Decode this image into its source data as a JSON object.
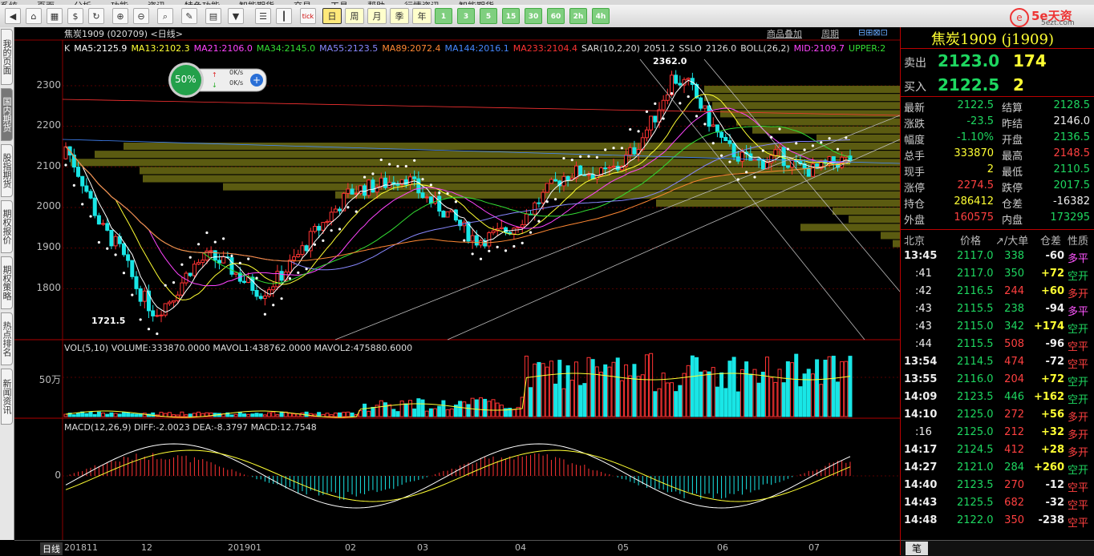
{
  "menubar": {
    "items": [
      "系统",
      "页面",
      "分析",
      "功能",
      "资讯",
      "特色功能",
      "智能期货",
      "交易",
      "工具",
      "帮助",
      "行情资讯",
      "智能期货"
    ]
  },
  "toolbar": {
    "periods": [
      "日",
      "周",
      "月",
      "季",
      "年"
    ],
    "cycles": [
      "1",
      "3",
      "5",
      "15",
      "30",
      "60",
      "2h",
      "4h"
    ],
    "logo_text": "5e天资",
    "logo_sub": "5ezt.com"
  },
  "left_tabs": [
    "我的页面",
    "国内期货",
    "股指期货",
    "期权报价",
    "期权策略",
    "热点排名",
    "新闻资讯"
  ],
  "chart": {
    "title_line": "焦炭1909 (020709) <日线>",
    "link_overlay": "商品叠加",
    "link_period": "周期",
    "indicators": [
      {
        "text": "K",
        "color": "#dddddd"
      },
      {
        "text": "MA5:2125.9",
        "color": "#ffffff"
      },
      {
        "text": "MA13:2102.3",
        "color": "#ffff33"
      },
      {
        "text": "MA21:2106.0",
        "color": "#ff44ff"
      },
      {
        "text": "MA34:2145.0",
        "color": "#33dd33"
      },
      {
        "text": "MA55:2123.5",
        "color": "#8888ff"
      },
      {
        "text": "MA89:2072.4",
        "color": "#ff8833"
      },
      {
        "text": "MA144:2016.1",
        "color": "#4488ff"
      },
      {
        "text": "MA233:2104.4",
        "color": "#ff3333"
      },
      {
        "text": "SAR(10,2,20)",
        "color": "#dddddd"
      },
      {
        "text": "2051.2",
        "color": "#dddddd"
      },
      {
        "text": "SSLO",
        "color": "#dddddd"
      },
      {
        "text": "2126.0",
        "color": "#dddddd"
      },
      {
        "text": "BOLL(26,2)",
        "color": "#dddddd"
      },
      {
        "text": "MID:2109.7",
        "color": "#ff44ff"
      },
      {
        "text": "UPPER:2",
        "color": "#33dd33"
      }
    ],
    "y_ticks": [
      "2300",
      "2200",
      "2100",
      "2000",
      "1900",
      "1800"
    ],
    "high_label": "2362.0",
    "low_label": "1721.5",
    "speed_widget": {
      "percent": "50%",
      "up": "0K/s",
      "down": "0K/s"
    },
    "vol_header": "VOL(5,10) VOLUME:333870.0000 MAVOL1:438762.0000 MAVOL2:475880.6000",
    "vol_tick": "50万",
    "macd_header": "MACD(12,26,9) DIFF:-2.0023 DEA:-8.3797 MACD:12.7548",
    "macd_tick": "0",
    "x_period": "日线",
    "x_labels": [
      "201811",
      "12",
      "201901",
      "02",
      "03",
      "04",
      "05",
      "06",
      "07"
    ]
  },
  "quote": {
    "name": "焦炭1909 (j1909)",
    "sell_label": "卖出",
    "sell_price": "2123.0",
    "sell_vol": "174",
    "buy_label": "买入",
    "buy_price": "2122.5",
    "buy_vol": "2",
    "stats": [
      {
        "l1": "最新",
        "v1": "2122.5",
        "c1": "g",
        "l2": "结算",
        "v2": "2128.5",
        "c2": "g"
      },
      {
        "l1": "涨跌",
        "v1": "-23.5",
        "c1": "g",
        "l2": "昨结",
        "v2": "2146.0",
        "c2": "w"
      },
      {
        "l1": "幅度",
        "v1": "-1.10%",
        "c1": "g",
        "l2": "开盘",
        "v2": "2136.5",
        "c2": "g"
      },
      {
        "l1": "总手",
        "v1": "333870",
        "c1": "y",
        "l2": "最高",
        "v2": "2148.5",
        "c2": "r"
      },
      {
        "l1": "现手",
        "v1": "2",
        "c1": "y",
        "l2": "最低",
        "v2": "2110.5",
        "c2": "g"
      },
      {
        "l1": "涨停",
        "v1": "2274.5",
        "c1": "r",
        "l2": "跌停",
        "v2": "2017.5",
        "c2": "g"
      },
      {
        "l1": "持仓",
        "v1": "286412",
        "c1": "y",
        "l2": "仓差",
        "v2": "-16382",
        "c2": "w"
      },
      {
        "l1": "外盘",
        "v1": "160575",
        "c1": "r",
        "l2": "内盘",
        "v2": "173295",
        "c2": "g"
      }
    ],
    "tick_header": [
      "北京",
      "价格",
      "↗/大单",
      "仓差",
      "性质"
    ],
    "ticks": [
      {
        "t": "13:45",
        "p": "2117.0",
        "v": "338",
        "vc": "g",
        "d": "-60",
        "n": "多平",
        "nc": "pk"
      },
      {
        "t": ":41",
        "p": "2117.0",
        "v": "350",
        "vc": "g",
        "d": "+72",
        "n": "空开",
        "nc": "g"
      },
      {
        "t": ":42",
        "p": "2116.5",
        "v": "244",
        "vc": "r",
        "d": "+60",
        "n": "多开",
        "nc": "r"
      },
      {
        "t": ":43",
        "p": "2115.5",
        "v": "238",
        "vc": "g",
        "d": "-94",
        "n": "多平",
        "nc": "pk"
      },
      {
        "t": ":43",
        "p": "2115.0",
        "v": "342",
        "vc": "g",
        "d": "+174",
        "n": "空开",
        "nc": "g"
      },
      {
        "t": ":44",
        "p": "2115.5",
        "v": "508",
        "vc": "r",
        "d": "-96",
        "n": "空平",
        "nc": "r"
      },
      {
        "t": "13:54",
        "p": "2114.5",
        "v": "474",
        "vc": "r",
        "d": "-72",
        "n": "空平",
        "nc": "r"
      },
      {
        "t": "13:55",
        "p": "2116.0",
        "v": "204",
        "vc": "r",
        "d": "+72",
        "n": "空开",
        "nc": "g"
      },
      {
        "t": "14:09",
        "p": "2123.5",
        "v": "446",
        "vc": "g",
        "d": "+162",
        "n": "空开",
        "nc": "g"
      },
      {
        "t": "14:10",
        "p": "2125.0",
        "v": "272",
        "vc": "r",
        "d": "+56",
        "n": "多开",
        "nc": "r"
      },
      {
        "t": ":16",
        "p": "2125.0",
        "v": "212",
        "vc": "r",
        "d": "+32",
        "n": "多开",
        "nc": "r"
      },
      {
        "t": "14:17",
        "p": "2124.5",
        "v": "412",
        "vc": "r",
        "d": "+28",
        "n": "多开",
        "nc": "r"
      },
      {
        "t": "14:27",
        "p": "2121.0",
        "v": "284",
        "vc": "g",
        "d": "+260",
        "n": "空开",
        "nc": "g"
      },
      {
        "t": "14:40",
        "p": "2123.5",
        "v": "270",
        "vc": "r",
        "d": "-12",
        "n": "空平",
        "nc": "r"
      },
      {
        "t": "14:43",
        "p": "2125.5",
        "v": "682",
        "vc": "r",
        "d": "-32",
        "n": "空平",
        "nc": "r"
      },
      {
        "t": "14:48",
        "p": "2122.0",
        "v": "350",
        "vc": "r",
        "d": "-238",
        "n": "空平",
        "nc": "r"
      }
    ],
    "footer_tab": "笔"
  }
}
